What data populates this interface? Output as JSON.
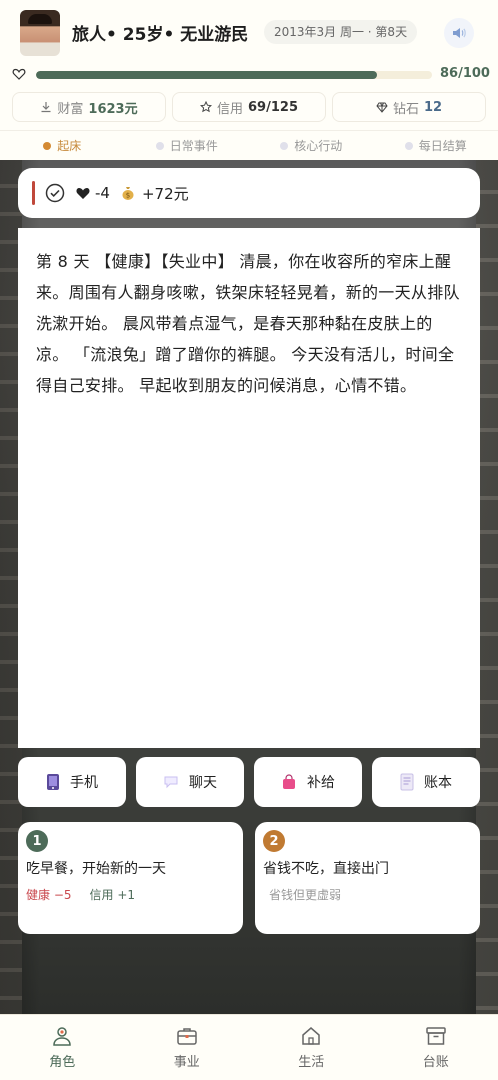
{
  "header": {
    "character_title": "旅人• 25岁• 无业游民",
    "date_badge": "2013年3月 周一 · 第8天",
    "hp_text": "86/100",
    "hp_fraction": 0.86
  },
  "stats": {
    "wealth_label": "财富",
    "wealth_value": "1623元",
    "credit_label": "信用",
    "credit_value": "69/125",
    "diamond_label": "钻石",
    "diamond_value": "12"
  },
  "phases": [
    "起床",
    "日常事件",
    "核心行动",
    "每日结算"
  ],
  "event": {
    "hp_change": "-4",
    "money_change": "+72元"
  },
  "story": {
    "text": "第 8 天 【健康】【失业中】 清晨，你在收容所的窄床上醒来。周围有人翻身咳嗽，铁架床轻轻晃着，新的一天从排队洗漱开始。 晨风带着点湿气，是春天那种黏在皮肤上的凉。 「流浪兔」蹭了蹭你的裤腿。 今天没有活儿，时间全得自己安排。 早起收到朋友的问候消息，心情不错。"
  },
  "tools": [
    "手机",
    "聊天",
    "补给",
    "账本"
  ],
  "choices": [
    {
      "num": "1",
      "title": "吃早餐，开始新的一天",
      "effect_neg": "健康 −5",
      "effect_pos": "信用 +1"
    },
    {
      "num": "2",
      "title": "省钱不吃，直接出门",
      "note": "省钱但更虚弱"
    }
  ],
  "nav": [
    "角色",
    "事业",
    "生活",
    "台账"
  ],
  "colors": {
    "accent_green": "#4d6b59",
    "accent_orange": "#c07a32",
    "negative_red": "#c9484e"
  }
}
